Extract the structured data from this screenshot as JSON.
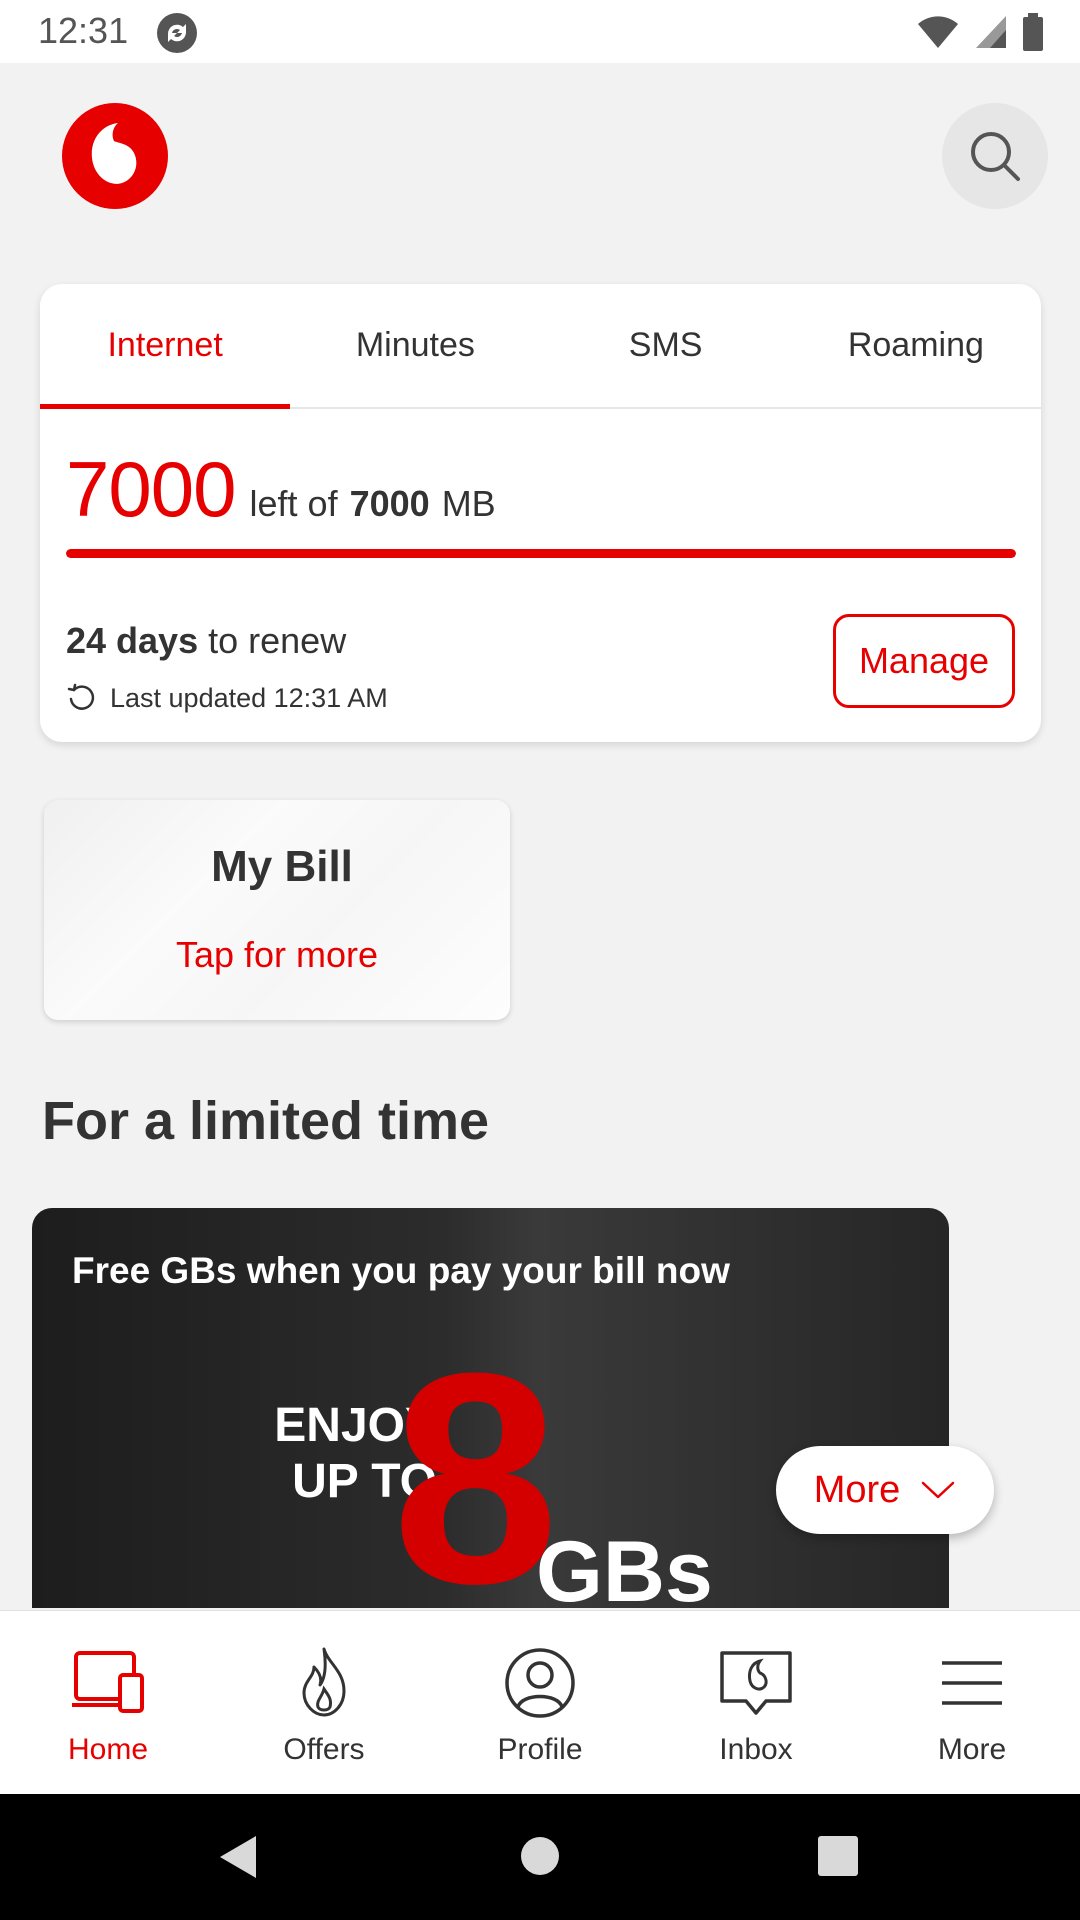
{
  "status_bar": {
    "time": "12:31"
  },
  "usage": {
    "tabs": [
      "Internet",
      "Minutes",
      "SMS",
      "Roaming"
    ],
    "active_tab": "Internet",
    "remaining": "7000",
    "left_of_label": "left of",
    "total": "7000",
    "unit": "MB",
    "remaining_fraction": 1.0,
    "renew_days": "24 days",
    "renew_label": "to renew",
    "last_updated": "Last updated 12:31 AM",
    "manage_label": "Manage"
  },
  "bill_card": {
    "title": "My Bill",
    "subtitle": "Tap for more"
  },
  "section_title": "For a limited time",
  "promo": {
    "title": "Free GBs when you pay your bill now",
    "enjoy_line1": "ENJOY",
    "enjoy_line2": "UP TO",
    "big_number": "8",
    "gbs": "GBs"
  },
  "more_pill": {
    "label": "More"
  },
  "bottom_nav": {
    "items": [
      {
        "label": "Home",
        "icon": "devices-icon",
        "active": true
      },
      {
        "label": "Offers",
        "icon": "flame-icon",
        "active": false
      },
      {
        "label": "Profile",
        "icon": "profile-icon",
        "active": false
      },
      {
        "label": "Inbox",
        "icon": "inbox-icon",
        "active": false
      },
      {
        "label": "More",
        "icon": "menu-icon",
        "active": false
      }
    ]
  },
  "colors": {
    "brand_red": "#e60000",
    "background": "#f2f2f2",
    "text": "#333333"
  }
}
